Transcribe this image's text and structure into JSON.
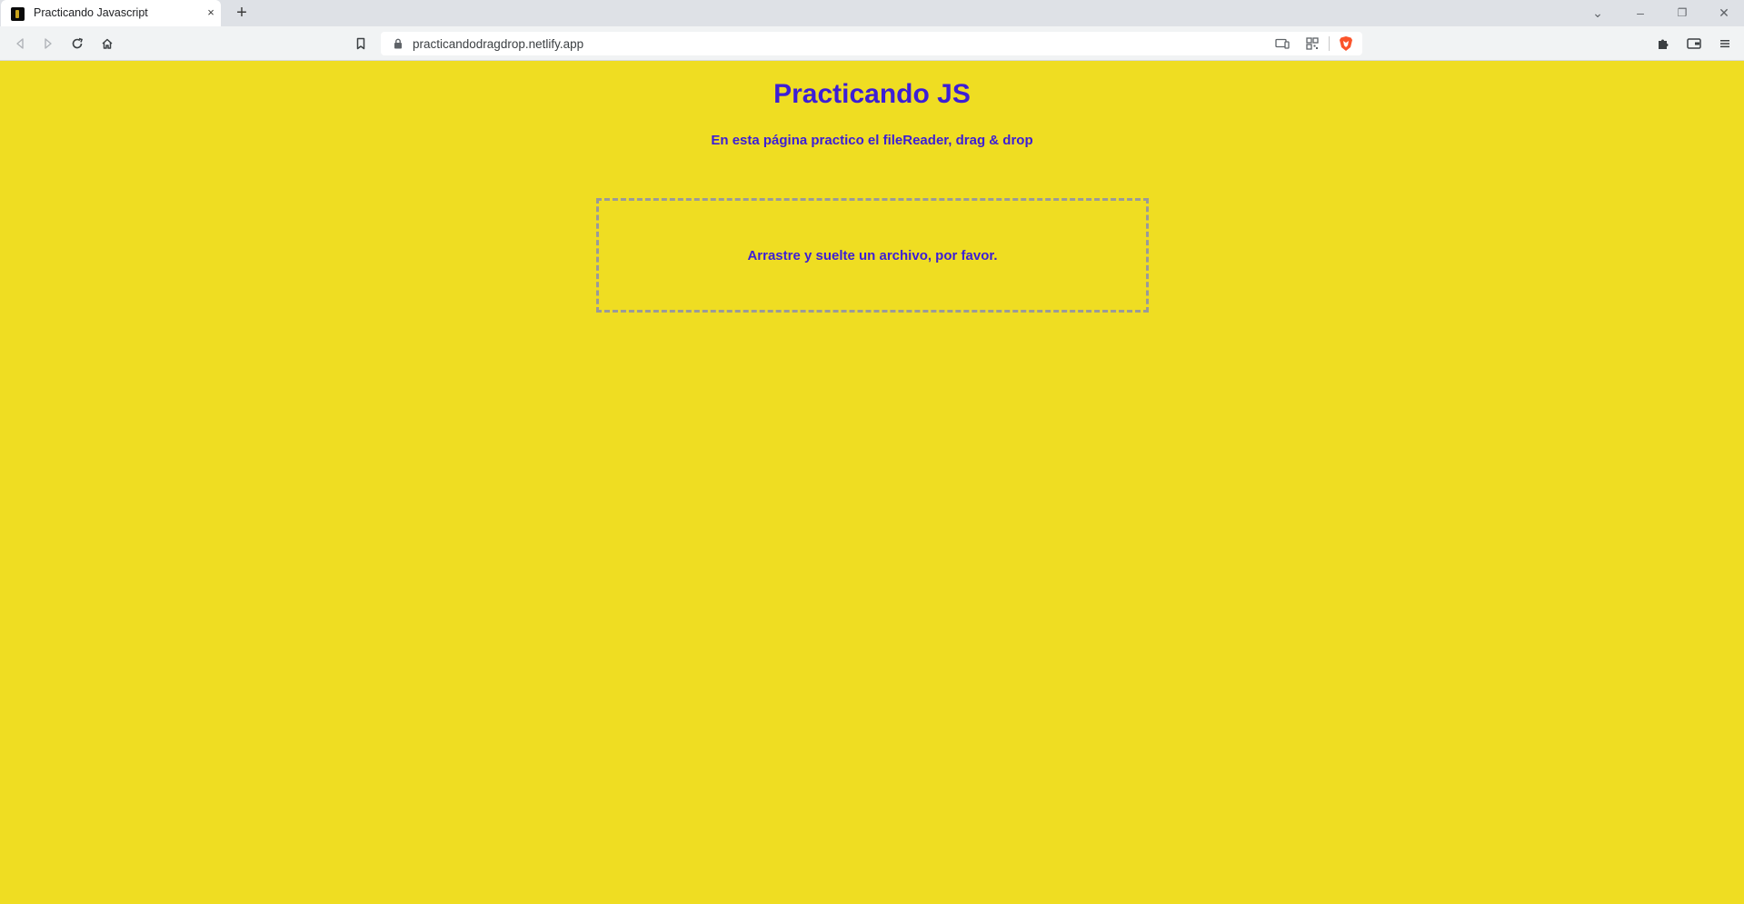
{
  "browser": {
    "tab": {
      "title": "Practicando Javascript",
      "close_glyph": "×"
    },
    "new_tab_glyph": "+",
    "window_controls": {
      "tabs_list": "⌄",
      "minimize": "–",
      "restore": "❐",
      "close": "✕"
    },
    "address_bar": {
      "url": "practicandodragdrop.netlify.app"
    }
  },
  "page": {
    "title": "Practicando JS",
    "subtitle": "En esta página practico el fileReader, drag & drop",
    "drop_zone_text": "Arrastre y suelte un archivo, por favor."
  },
  "colors": {
    "page_background": "#efdd22",
    "text_accent": "#3c1ed6",
    "drop_zone_border": "#9a9a9a"
  },
  "icons": [
    "back-icon",
    "forward-icon",
    "reload-icon",
    "home-icon",
    "bookmark-icon",
    "lock-icon",
    "cast-icon",
    "qr-code-icon",
    "brave-shield-icon",
    "extensions-icon",
    "wallet-icon",
    "menu-icon"
  ]
}
